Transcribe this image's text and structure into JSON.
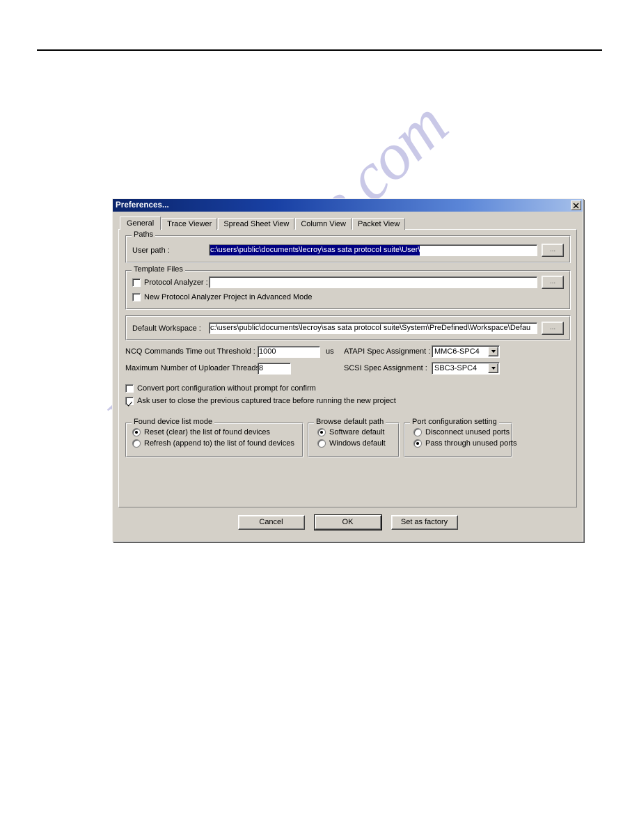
{
  "watermark": {
    "text": "manualshive.com"
  },
  "dialog": {
    "title": "Preferences...",
    "close_label": "✕",
    "tabs": [
      {
        "label": "General",
        "active": true
      },
      {
        "label": "Trace Viewer",
        "active": false
      },
      {
        "label": "Spread Sheet View",
        "active": false
      },
      {
        "label": "Column View",
        "active": false
      },
      {
        "label": "Packet View",
        "active": false
      }
    ],
    "paths": {
      "group_title": "Paths",
      "user_path_label": "User path :",
      "user_path_value": "c:\\users\\public\\documents\\lecroy\\sas sata protocol suite\\User\\",
      "browse_label": "..."
    },
    "template_files": {
      "group_title": "Template Files",
      "protocol_analyzer_label": "Protocol Analyzer :",
      "protocol_analyzer_checked": false,
      "protocol_analyzer_value": "",
      "browse_label": "...",
      "advanced_mode_label": "New Protocol Analyzer Project in Advanced Mode",
      "advanced_mode_checked": false
    },
    "workspace": {
      "label": "Default Workspace :",
      "value": "c:\\users\\public\\documents\\lecroy\\sas sata protocol suite\\System\\PreDefined\\Workspace\\Defau",
      "browse_label": "..."
    },
    "settings": {
      "ncq_label": "NCQ Commands Time out Threshold :",
      "ncq_value": "1000",
      "ncq_unit": "us",
      "threads_label": "Maximum Number of Uploader Threads:",
      "threads_value": "8",
      "atapi_label": "ATAPI Spec Assignment :",
      "atapi_value": "MMC6-SPC4",
      "scsi_label": "SCSI Spec Assignment :",
      "scsi_value": "SBC3-SPC4"
    },
    "checks": {
      "convert_label": "Convert port configuration without prompt for confirm",
      "convert_checked": false,
      "ask_label": "Ask user to close the previous captured trace before running the new project",
      "ask_checked": true
    },
    "found_devices": {
      "group_title": "Found device list mode",
      "options": [
        {
          "label": "Reset (clear) the list of found devices",
          "selected": true
        },
        {
          "label": "Refresh (append to) the list of found devices",
          "selected": false
        }
      ]
    },
    "browse_default": {
      "group_title": "Browse default path",
      "options": [
        {
          "label": "Software default",
          "selected": true
        },
        {
          "label": "Windows default",
          "selected": false
        }
      ]
    },
    "port_config": {
      "group_title": "Port configuration setting",
      "options": [
        {
          "label": "Disconnect unused ports",
          "selected": false
        },
        {
          "label": "Pass through unused ports",
          "selected": true
        }
      ]
    },
    "buttons": {
      "cancel": "Cancel",
      "ok": "OK",
      "factory": "Set as factory"
    }
  }
}
